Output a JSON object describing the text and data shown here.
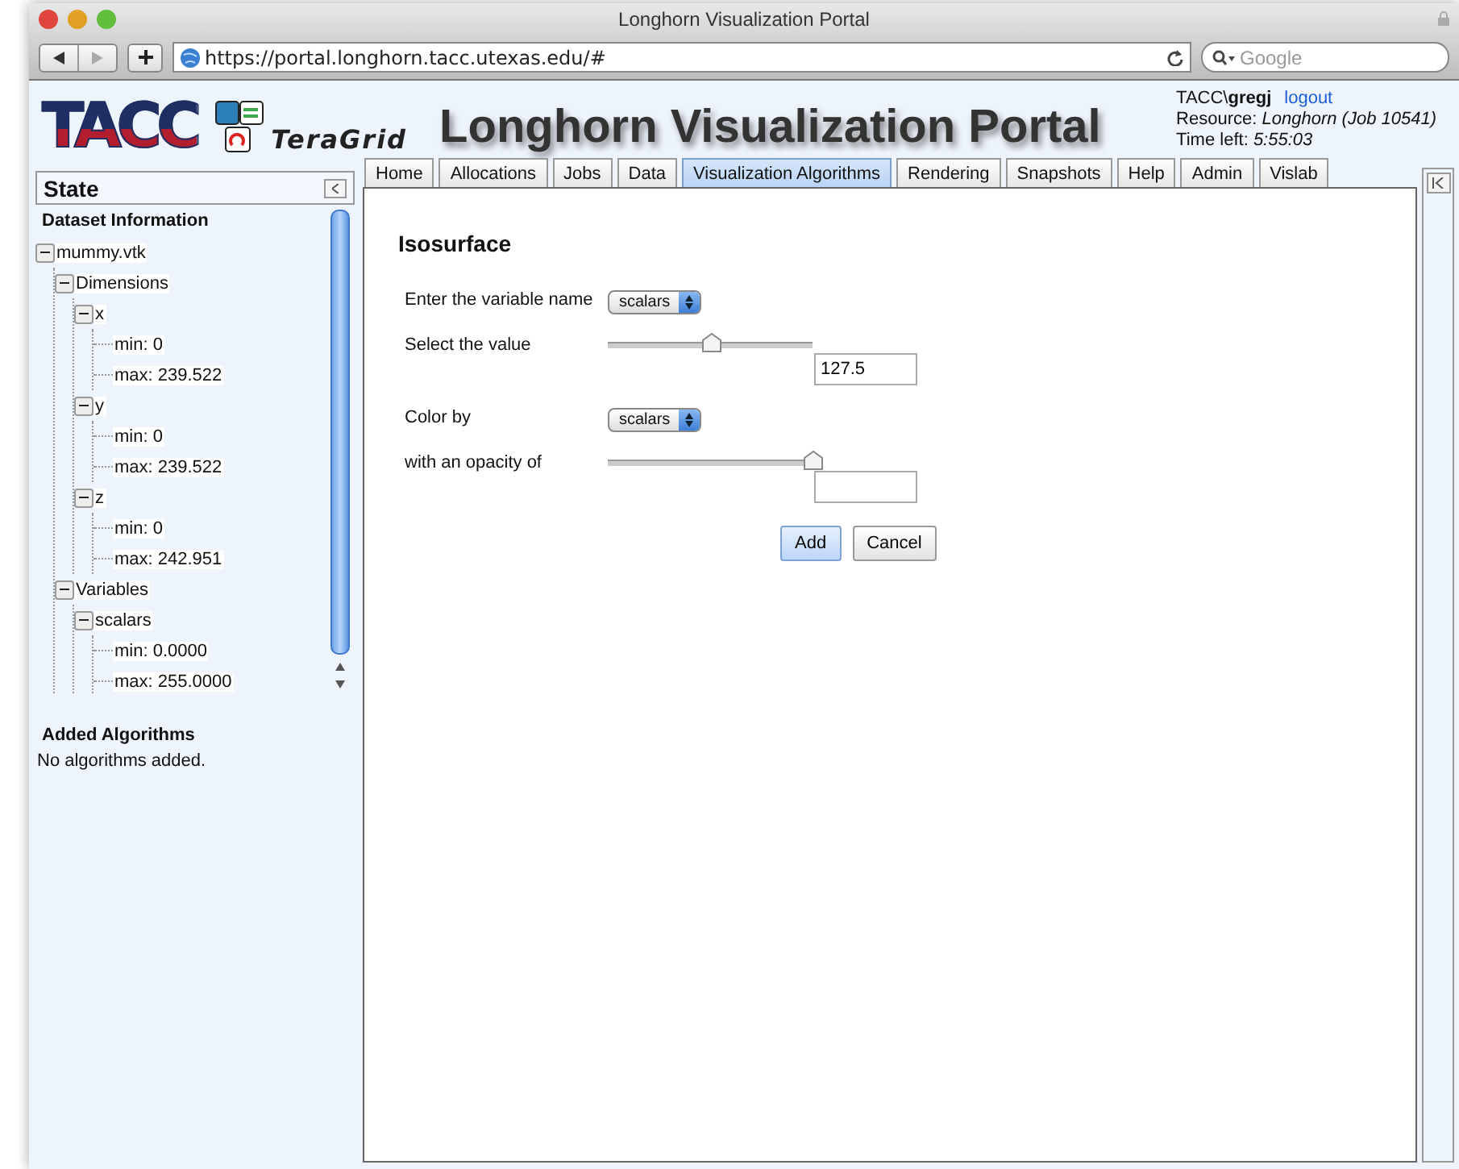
{
  "window": {
    "title": "Longhorn Visualization Portal"
  },
  "toolbar": {
    "address": "https://portal.longhorn.tacc.utexas.edu/#",
    "search": {
      "placeholder": "Google"
    }
  },
  "header": {
    "logo": "TACC",
    "partner_logo": "TeraGrid",
    "title": "Longhorn Visualization Portal",
    "user": "TACC\\**gregj**",
    "logout": "logout",
    "resource": "Resource: *Longhorn (Job 10541)*",
    "time_left": "Time left: *5:55:03*"
  },
  "sidebar": {
    "title": "State",
    "section": "Dataset Information",
    "tree": [
      {
        "label": "mummy.vtk",
        "expanded": true,
        "children": [
          {
            "label": "Dimensions",
            "expanded": true,
            "children": [
              {
                "label": "x",
                "expanded": true,
                "children": [
                  {
                    "label": "min: 0"
                  },
                  {
                    "label": "max: 239.522"
                  }
                ]
              },
              {
                "label": "y",
                "expanded": true,
                "children": [
                  {
                    "label": "min: 0"
                  },
                  {
                    "label": "max: 239.522"
                  }
                ]
              },
              {
                "label": "z",
                "expanded": true,
                "children": [
                  {
                    "label": "min: 0"
                  },
                  {
                    "label": "max: 242.951"
                  }
                ]
              }
            ]
          },
          {
            "label": "Variables",
            "expanded": true,
            "children": [
              {
                "label": "scalars",
                "expanded": true,
                "children": [
                  {
                    "label": "min: 0.0000"
                  },
                  {
                    "label": "max: 255.0000"
                  }
                ]
              }
            ]
          }
        ]
      }
    ],
    "algorithms_title": "Added Algorithms",
    "algorithms_note": "No algorithms added."
  },
  "tabs": [
    {
      "label": "Home",
      "selected": false
    },
    {
      "label": "Allocations",
      "selected": false
    },
    {
      "label": "Jobs",
      "selected": false
    },
    {
      "label": "Data",
      "selected": false
    },
    {
      "label": "Visualization Algorithms",
      "selected": true
    },
    {
      "label": "Rendering",
      "selected": false
    },
    {
      "label": "Snapshots",
      "selected": false
    },
    {
      "label": "Help",
      "selected": false
    },
    {
      "label": "Admin",
      "selected": false
    },
    {
      "label": "Vislab",
      "selected": false
    }
  ],
  "form": {
    "title": "Isosurface",
    "rows": [
      {
        "kind": "select",
        "label": "Enter the variable name",
        "value": "scalars"
      },
      {
        "kind": "slider",
        "label": "Select the value",
        "level": 0.5,
        "value": "127.5"
      },
      {
        "kind": "select",
        "label": "Color by",
        "value": "scalars"
      },
      {
        "kind": "slider",
        "label": "with an opacity of",
        "level": 1.0
      }
    ],
    "buttons": [
      {
        "label": "Add",
        "primary": true
      },
      {
        "label": "Cancel",
        "primary": false
      }
    ]
  }
}
